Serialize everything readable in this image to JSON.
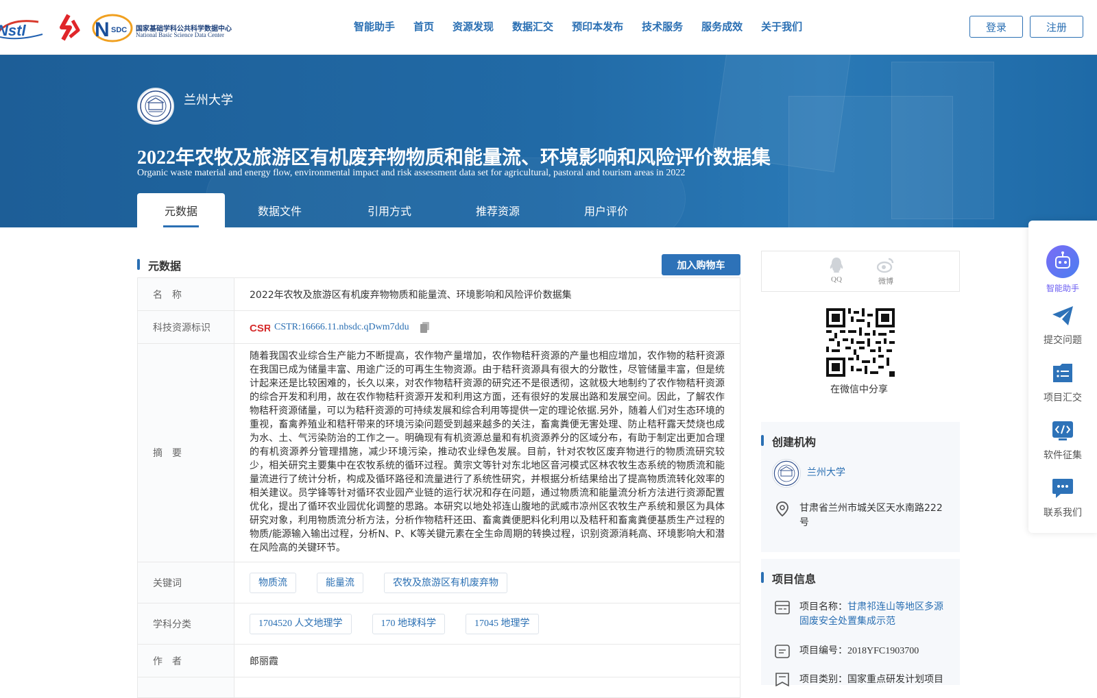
{
  "header": {
    "nav": [
      "智能助手",
      "首页",
      "资源发现",
      "数据汇交",
      "预印本发布",
      "技术服务",
      "服务成效",
      "关于我们"
    ],
    "login_label": "登录",
    "register_label": "注册",
    "nsdc_logo_cn": "国家基础学科公共科学数据中心",
    "nsdc_logo_en": "National Basic Science Data Center"
  },
  "hero": {
    "institution": "兰州大学",
    "title": "2022年农牧及旅游区有机废弃物物质和能量流、环境影响和风险评价数据集",
    "subtitle": "Organic waste material and energy flow, environmental impact and risk assessment data set for agricultural, pastoral and tourism areas in 2022",
    "tabs": [
      "元数据",
      "数据文件",
      "引用方式",
      "推荐资源",
      "用户评价"
    ]
  },
  "metadata": {
    "section_title": "元数据",
    "cart_label": "加入购物车",
    "rows": {
      "name_key": "名　称",
      "name_val": "2022年农牧及旅游区有机废弃物物质和能量流、环境影响和风险评价数据集",
      "id_key": "科技资源标识",
      "id_val": "CSTR:16666.11.nbsdc.qDwm7ddu",
      "abstract_key": "摘　要",
      "abstract_val": "随着我国农业综合生产能力不断提高，农作物产量增加，农作物秸秆资源的产量也相应增加，农作物的秸秆资源在我国已成为储量丰富、用途广泛的可再生生物资源。由于秸秆资源具有很大的分散性，尽管储量丰富，但是统计起来还是比较困难的，长久以来，对农作物秸秆资源的研究还不是很透彻，这就极大地制约了农作物秸秆资源的综合开发和利用，故在农作物秸秆资源开发和利用这方面，还有很好的发展出路和发展空间。因此，了解农作物秸秆资源储量，可以为秸秆资源的可持续发展和综合利用等提供一定的理论依据.另外，随着人们对生态环境的重视，畜禽养殖业和秸秆带来的环境污染问题受到越来越多的关注，畜禽粪便无害处理、防止秸秆露天焚烧也成为水、土、气污染防治的工作之一。明确现有有机资源总量和有机资源养分的区域分布，有助于制定出更加合理的有机资源养分管理措施，减少环境污染，推动农业绿色发展。目前，针对农牧区废弃物进行的物质流研究较少，相关研究主要集中在农牧系统的循环过程。黄宗文等针对东北地区音河模式区林农牧生态系统的物质流和能量流进行了统计分析，构成及循环路径和流量进行了系统性研究，并根据分析结果给出了提高物质流转化效率的相关建议。员学锋等针对循环农业园产业链的运行状况和存在问题，通过物质流和能量流分析方法进行资源配置优化，提出了循环农业园优化调整的思路。本研究以地处祁连山腹地的武威市凉州区农牧生产系统和景区为具体研究对象，利用物质流分析方法，分析作物秸秆还田、畜禽粪便肥料化利用以及秸秆和畜禽粪便基质生产过程的物质/能源输入输出过程，分析N、P、K等关键元素在全生命周期的转换过程，识别资源消耗高、环境影响大和潜在风险高的关键环节。",
      "keywords_key": "关键词",
      "keywords": [
        "物质流",
        "能量流",
        "农牧及旅游区有机废弃物"
      ],
      "subject_key": "学科分类",
      "subjects": [
        "1704520 人文地理学",
        "170 地球科学",
        "17045 地理学"
      ],
      "author_key": "作　者",
      "author_val": "郎丽霞"
    }
  },
  "share": {
    "qq": "QQ",
    "weibo": "微博",
    "wechat_caption": "在微信中分享"
  },
  "creator": {
    "section_title": "创建机构",
    "name": "兰州大学",
    "address": "甘肃省兰州市城关区天水南路222号"
  },
  "project": {
    "section_title": "项目信息",
    "name_label": "项目名称：",
    "name_value": "甘肃祁连山等地区多源固废安全处置集成示范",
    "code_label": "项目编号：",
    "code_value": "2018YFC1903700",
    "category_label": "项目类别：",
    "category_value": "国家重点研发计划项目"
  },
  "sidebar": [
    "智能助手",
    "提交问题",
    "项目汇交",
    "软件征集",
    "联系我们"
  ],
  "colors": {
    "brand_blue": "#2a6fb3",
    "hero_blue": "#216aa6",
    "robot_purple": "#6a5cf2"
  }
}
